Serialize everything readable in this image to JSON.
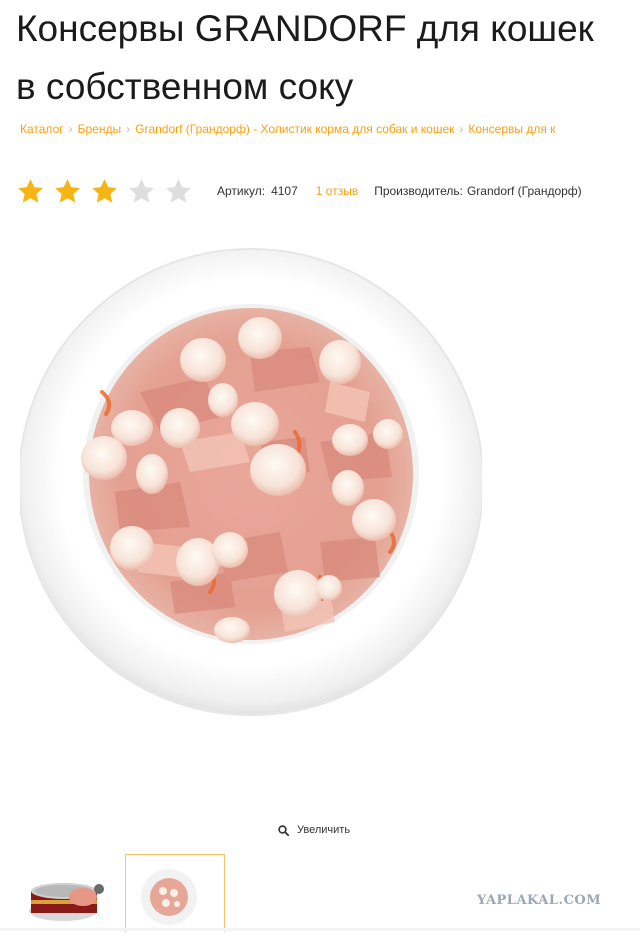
{
  "product": {
    "title_line1": "Консервы GRANDORF для кошек",
    "title_line2": "в собственном соку",
    "rating_stars": 3,
    "rating_max": 5,
    "article_label": "Артикул:",
    "article_value": "4107",
    "reviews_link": "1 отзыв",
    "manufacturer_label": "Производитель:",
    "manufacturer_value": "Grandorf (Грандорф)"
  },
  "breadcrumbs": [
    "Каталог",
    "Бренды",
    "Grandorf (Грандорф) - Холистик корма для собак и кошек",
    "Консервы для к"
  ],
  "gallery": {
    "zoom_label": "Увеличить",
    "thumbnails": [
      "can-thumbnail",
      "bowl-thumbnail"
    ],
    "active_thumbnail": 1
  },
  "watermark": "YAPLAKAL.COM",
  "colors": {
    "accent": "#ff9e0d",
    "star_filled": "#f7b513",
    "star_empty": "#dedede"
  }
}
